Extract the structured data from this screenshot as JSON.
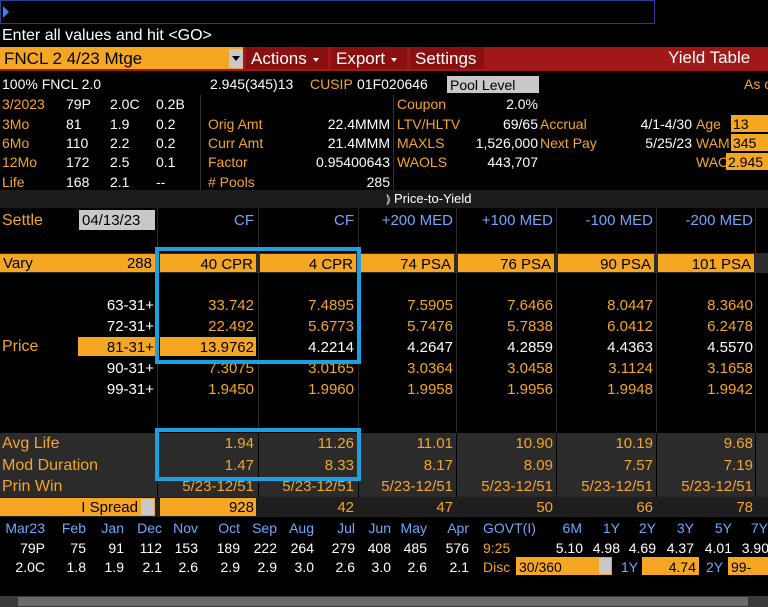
{
  "command": {
    "prompt": "Enter all values and hit <GO>"
  },
  "header": {
    "ticker": "FNCL 2 4/23 Mtge",
    "menus": [
      "Actions",
      "Export",
      "Settings"
    ],
    "function_title": "Yield Table"
  },
  "security": {
    "name": "100% FNCL 2.0",
    "price_line": "2.945(345)13",
    "cusip_label": "CUSIP",
    "cusip": "01F020646",
    "pool_level": "Pool Level",
    "as_label": "As c"
  },
  "history": [
    {
      "label": "3/2023",
      "a": "79P",
      "b": "2.0C",
      "c": "0.2B"
    },
    {
      "label": "3Mo",
      "a": "81",
      "b": "1.9",
      "c": "0.2"
    },
    {
      "label": "6Mo",
      "a": "110",
      "b": "2.2",
      "c": "0.2"
    },
    {
      "label": "12Mo",
      "a": "172",
      "b": "2.5",
      "c": "0.1"
    },
    {
      "label": "Life",
      "a": "168",
      "b": "2.1",
      "c": "--"
    }
  ],
  "amounts": {
    "orig_amt_label": "Orig Amt",
    "orig_amt": "22.4MMM",
    "curr_amt_label": "Curr Amt",
    "curr_amt": "21.4MMM",
    "factor_label": "Factor",
    "factor": "0.95400643",
    "pools_label": "# Pools",
    "pools": "285"
  },
  "pool_stats": {
    "coupon_label": "Coupon",
    "coupon": "2.0%",
    "ltv_label": "LTV/HLTV",
    "ltv": "69/65",
    "maxls_label": "MAXLS",
    "maxls": "1,526,000",
    "waols_label": "WAOLS",
    "waols": "443,707",
    "accrual_label": "Accrual",
    "accrual": "4/1-4/30",
    "nextpay_label": "Next Pay",
    "nextpay": "5/25/23",
    "age_label": "Age",
    "age": "13",
    "wam_label": "WAM",
    "wam": "345",
    "wac_label": "WAC",
    "wac": "2.945"
  },
  "table": {
    "section_tab": "Price-to-Yield",
    "settle_label": "Settle",
    "settle_date": "04/13/23",
    "vary_label": "Vary",
    "vary_value": "288",
    "price_label": "Price",
    "columns": [
      {
        "head": "CF",
        "vary": "40 CPR"
      },
      {
        "head": "CF",
        "vary": "4 CPR"
      },
      {
        "head": "+200 MED",
        "vary": "74 PSA"
      },
      {
        "head": "+100 MED",
        "vary": "76 PSA"
      },
      {
        "head": "-100 MED",
        "vary": "90 PSA"
      },
      {
        "head": "-200 MED",
        "vary": "101 PSA"
      }
    ],
    "prices": [
      {
        "price": "63-31+",
        "vals": [
          "33.742",
          "7.4895",
          "7.5905",
          "7.6466",
          "8.0447",
          "8.3640"
        ]
      },
      {
        "price": "72-31+",
        "vals": [
          "22.492",
          "5.6773",
          "5.7476",
          "5.7838",
          "6.0412",
          "6.2478"
        ]
      },
      {
        "price": "81-31+",
        "vals": [
          "13.9762",
          "4.2214",
          "4.2647",
          "4.2859",
          "4.4363",
          "4.5570"
        ]
      },
      {
        "price": "90-31+",
        "vals": [
          "7.3075",
          "3.0165",
          "3.0364",
          "3.0458",
          "3.1124",
          "3.1658"
        ]
      },
      {
        "price": "99-31+",
        "vals": [
          "1.9450",
          "1.9960",
          "1.9958",
          "1.9956",
          "1.9948",
          "1.9942"
        ]
      }
    ],
    "avg_life_label": "Avg Life",
    "avg_life": [
      "1.94",
      "11.26",
      "11.01",
      "10.90",
      "10.19",
      "9.68"
    ],
    "mod_dur_label": "Mod Duration",
    "mod_dur": [
      "1.47",
      "8.33",
      "8.17",
      "8.09",
      "7.57",
      "7.19"
    ],
    "prin_win_label": "Prin Win",
    "prin_win": [
      "5/23-12/51",
      "5/23-12/51",
      "5/23-12/51",
      "5/23-12/51",
      "5/23-12/51",
      "5/23-12/51"
    ],
    "spread_label": "I Spread",
    "spread": [
      "928",
      "42",
      "47",
      "50",
      "66",
      "78"
    ]
  },
  "footer": {
    "months": [
      "Mar23",
      "Feb",
      "Jan",
      "Dec",
      "Nov",
      "Oct",
      "Sep",
      "Aug",
      "Jul",
      "Jun",
      "May",
      "Apr"
    ],
    "row1": [
      "79P",
      "75",
      "91",
      "112",
      "153",
      "189",
      "222",
      "264",
      "279",
      "408",
      "485",
      "576"
    ],
    "row2": [
      "2.0C",
      "1.8",
      "1.9",
      "2.1",
      "2.6",
      "2.9",
      "2.9",
      "3.0",
      "2.6",
      "3.0",
      "2.6",
      "2.1"
    ],
    "govt_label": "GOVT(I)",
    "tenors": [
      "6M",
      "1Y",
      "2Y",
      "3Y",
      "5Y",
      "7Y"
    ],
    "time": "9:25",
    "yields": [
      "5.10",
      "4.98",
      "4.69",
      "4.37",
      "4.01",
      "3.90"
    ],
    "disc_label": "Disc",
    "disc_value": "30/360",
    "f1y_label": "1Y",
    "f1y": "4.74",
    "f2y_label": "2Y",
    "f2y": "99-"
  },
  "colors": {
    "accent": "#f5a623",
    "highlight_box": "#1ba1e2",
    "menu_bar": "#a01818"
  }
}
